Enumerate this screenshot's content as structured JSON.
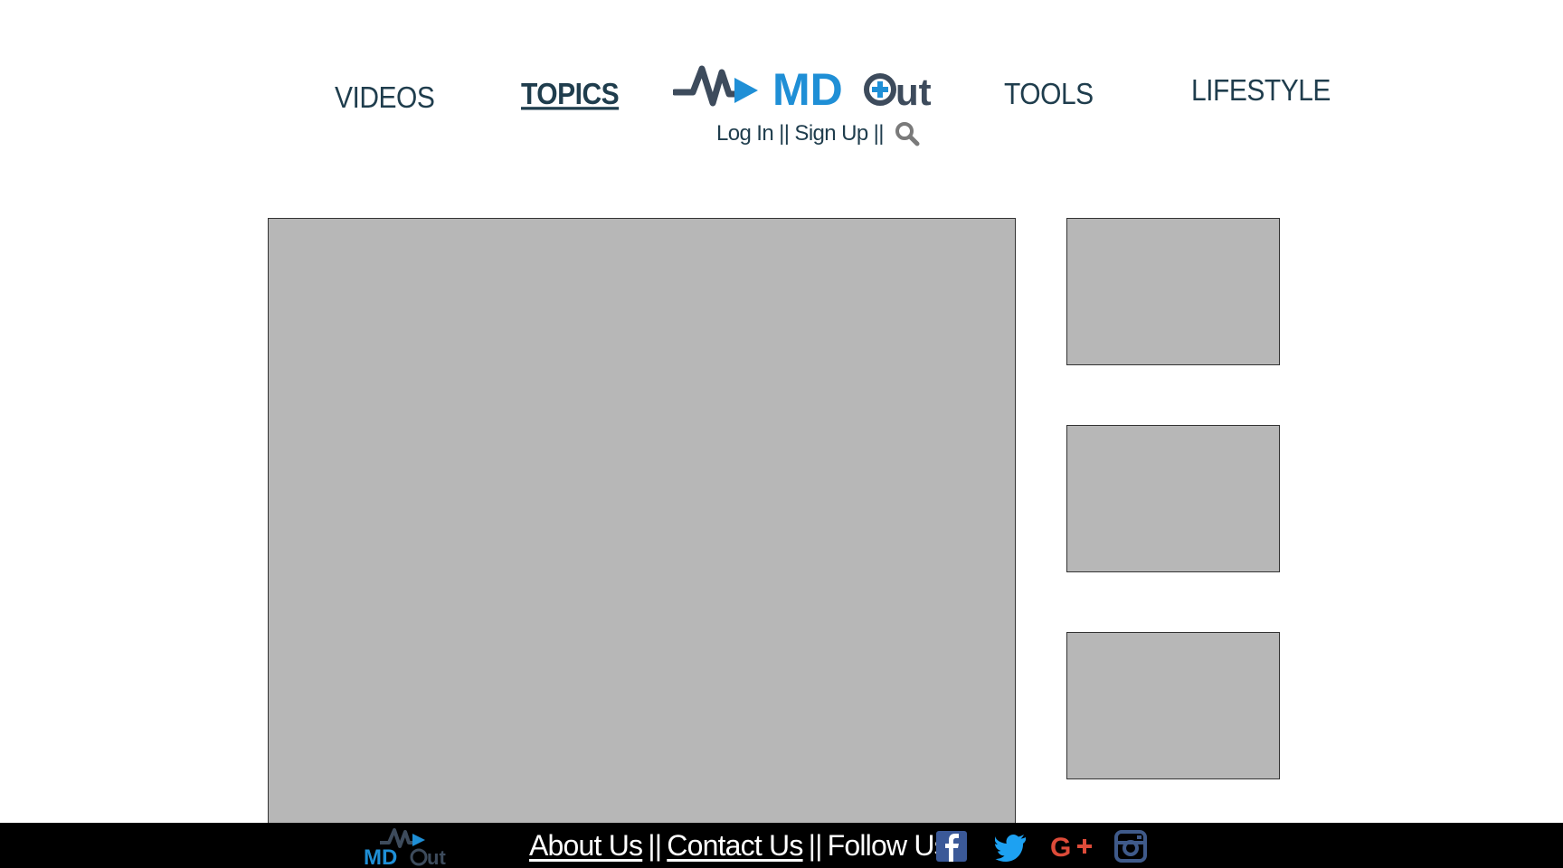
{
  "nav": {
    "videos": "VIDEOS",
    "topics": "TOPICS",
    "tools": "TOOLS",
    "lifestyle": "LIFESTYLE"
  },
  "logo": {
    "text_md": "MD",
    "text_out": "out",
    "colors": {
      "dark": "#3d4b5c",
      "blue": "#1f8fd6"
    }
  },
  "auth": {
    "login": "Log In",
    "sep1": "||",
    "signup": "Sign Up",
    "sep2": "||",
    "search_icon": "search-icon"
  },
  "footer": {
    "about": "About Us",
    "sep1": "||",
    "contact": "Contact Us",
    "sep2": "||",
    "follow": "Follow Us:",
    "social_icons": [
      "facebook-icon",
      "twitter-icon",
      "google-plus-icon",
      "instagram-icon"
    ]
  },
  "colors": {
    "nav_text": "#1f3d4d",
    "placeholder": "#b7b7b7",
    "footer_bg": "#000000",
    "facebook": "#3b5998",
    "twitter": "#1da1f2",
    "google_plus": "#dd4b39",
    "instagram": "#3f5a8a"
  }
}
